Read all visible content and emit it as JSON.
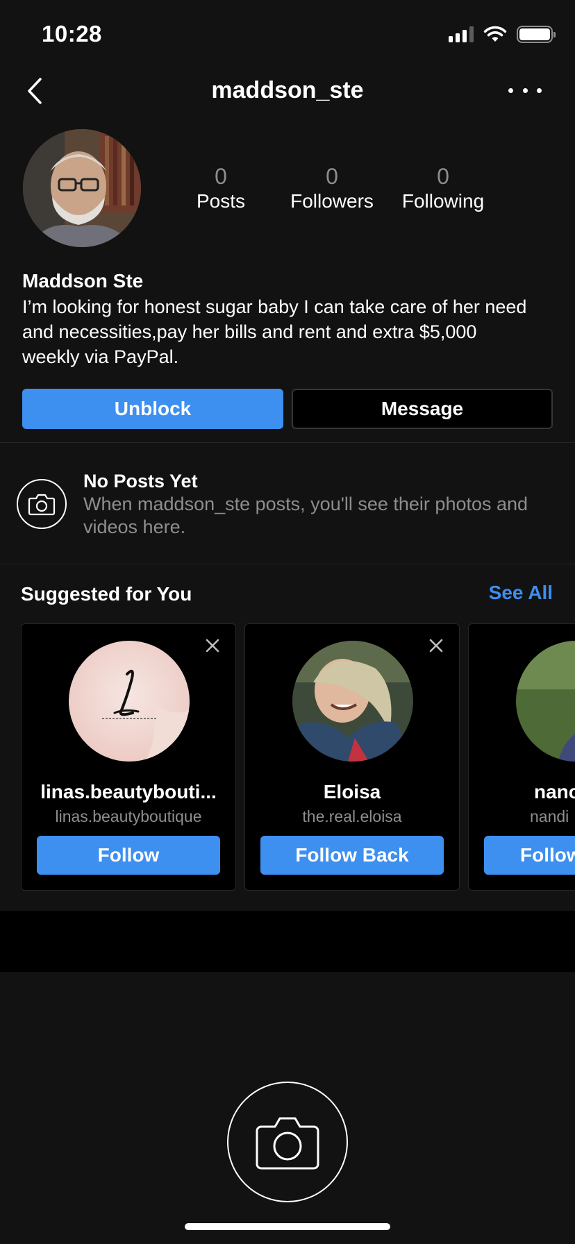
{
  "status_bar": {
    "time": "10:28",
    "signal_icon": "cellular-signal-icon",
    "wifi_icon": "wifi-icon",
    "battery_icon": "battery-icon"
  },
  "header": {
    "title": "maddson_ste",
    "back_icon": "chevron-left-icon",
    "more_icon": "more-horizontal-icon"
  },
  "profile": {
    "stats": [
      {
        "value": "0",
        "label": "Posts"
      },
      {
        "value": "0",
        "label": "Followers"
      },
      {
        "value": "0",
        "label": "Following"
      }
    ],
    "full_name": "Maddson Ste",
    "bio": "I’m looking for honest sugar baby I can take care of her need and necessities,pay her bills and rent and extra $5,000 weekly via PayPal.",
    "unblock_label": "Unblock",
    "message_label": "Message"
  },
  "no_posts": {
    "title": "No Posts Yet",
    "subtitle": "When maddson_ste posts, you'll see their photos and videos here.",
    "icon": "camera-icon"
  },
  "suggested": {
    "title": "Suggested for You",
    "see_all": "See All",
    "cards": [
      {
        "name": "linas.beautybouti...",
        "handle": "linas.beautyboutique",
        "button": "Follow"
      },
      {
        "name": "Eloisa",
        "handle": "the.real.eloisa",
        "button": "Follow Back"
      },
      {
        "name": "nanc",
        "handle": "nandi",
        "button": "Follow"
      }
    ]
  },
  "colors": {
    "accent": "#3d8ff0",
    "background": "#121212",
    "muted_text": "#8e8e8e"
  }
}
